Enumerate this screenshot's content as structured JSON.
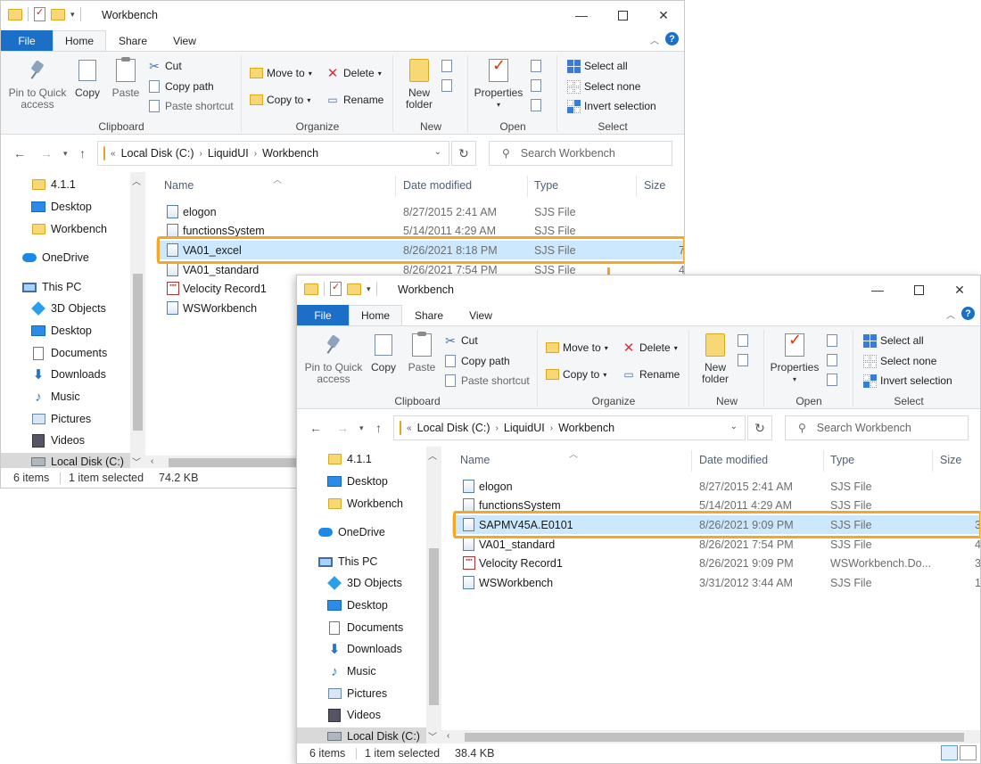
{
  "windows": [
    {
      "title": "Workbench",
      "tabs": {
        "file": "File",
        "home": "Home",
        "share": "Share",
        "view": "View"
      },
      "ribbon": {
        "pin_label": "Pin to Quick access",
        "copy": "Copy",
        "paste": "Paste",
        "cut": "Cut",
        "copy_path": "Copy path",
        "paste_shortcut": "Paste shortcut",
        "clipboard": "Clipboard",
        "move_to": "Move to",
        "copy_to": "Copy to",
        "delete": "Delete",
        "rename": "Rename",
        "organize": "Organize",
        "new_folder": "New folder",
        "new": "New",
        "properties": "Properties",
        "open": "Open",
        "select_all": "Select all",
        "select_none": "Select none",
        "invert_selection": "Invert selection",
        "select": "Select"
      },
      "address": {
        "prefix": "«",
        "crumbs": [
          "Local Disk (C:)",
          "LiquidUI",
          "Workbench"
        ]
      },
      "search_placeholder": "Search Workbench",
      "nav": [
        "4.1.1",
        "Desktop",
        "Workbench",
        "OneDrive",
        "This PC",
        "3D Objects",
        "Desktop",
        "Documents",
        "Downloads",
        "Music",
        "Pictures",
        "Videos",
        "Local Disk (C:)"
      ],
      "columns": {
        "name": "Name",
        "date": "Date modified",
        "type": "Type",
        "size": "Size"
      },
      "files": [
        {
          "name": "elogon",
          "date": "8/27/2015 2:41 AM",
          "type": "SJS File",
          "size": "",
          "icon": "sjs"
        },
        {
          "name": "functionsSystem",
          "date": "5/14/2011 4:29 AM",
          "type": "SJS File",
          "size": "",
          "icon": "sjs"
        },
        {
          "name": "VA01_excel",
          "date": "8/26/2021 8:18 PM",
          "type": "SJS File",
          "size": "7",
          "icon": "sjs"
        },
        {
          "name": "VA01_standard",
          "date": "8/26/2021 7:54 PM",
          "type": "SJS File",
          "size": "4",
          "icon": "sjs"
        },
        {
          "name": "Velocity Record1",
          "date": "",
          "type": "",
          "size": "",
          "icon": "rec"
        },
        {
          "name": "WSWorkbench",
          "date": "",
          "type": "",
          "size": "",
          "icon": "sjs"
        }
      ],
      "status": {
        "count": "6 items",
        "selected": "1 item selected",
        "size": "74.2 KB"
      }
    },
    {
      "title": "Workbench",
      "tabs": {
        "file": "File",
        "home": "Home",
        "share": "Share",
        "view": "View"
      },
      "ribbon": {
        "pin_label": "Pin to Quick access",
        "copy": "Copy",
        "paste": "Paste",
        "cut": "Cut",
        "copy_path": "Copy path",
        "paste_shortcut": "Paste shortcut",
        "clipboard": "Clipboard",
        "move_to": "Move to",
        "copy_to": "Copy to",
        "delete": "Delete",
        "rename": "Rename",
        "organize": "Organize",
        "new_folder": "New folder",
        "new": "New",
        "properties": "Properties",
        "open": "Open",
        "select_all": "Select all",
        "select_none": "Select none",
        "invert_selection": "Invert selection",
        "select": "Select"
      },
      "address": {
        "prefix": "«",
        "crumbs": [
          "Local Disk (C:)",
          "LiquidUI",
          "Workbench"
        ]
      },
      "search_placeholder": "Search Workbench",
      "nav": [
        "4.1.1",
        "Desktop",
        "Workbench",
        "OneDrive",
        "This PC",
        "3D Objects",
        "Desktop",
        "Documents",
        "Downloads",
        "Music",
        "Pictures",
        "Videos",
        "Local Disk (C:)"
      ],
      "columns": {
        "name": "Name",
        "date": "Date modified",
        "type": "Type",
        "size": "Size"
      },
      "files": [
        {
          "name": "elogon",
          "date": "8/27/2015 2:41 AM",
          "type": "SJS File",
          "size": "",
          "icon": "sjs"
        },
        {
          "name": "functionsSystem",
          "date": "5/14/2011 4:29 AM",
          "type": "SJS File",
          "size": "",
          "icon": "sjs"
        },
        {
          "name": "SAPMV45A.E0101",
          "date": "8/26/2021 9:09 PM",
          "type": "SJS File",
          "size": "3",
          "icon": "sjs"
        },
        {
          "name": "VA01_standard",
          "date": "8/26/2021 7:54 PM",
          "type": "SJS File",
          "size": "4",
          "icon": "sjs"
        },
        {
          "name": "Velocity Record1",
          "date": "8/26/2021 9:09 PM",
          "type": "WSWorkbench.Do...",
          "size": "3",
          "icon": "rec"
        },
        {
          "name": "WSWorkbench",
          "date": "3/31/2012 3:44 AM",
          "type": "SJS File",
          "size": "1",
          "icon": "sjs"
        }
      ],
      "status": {
        "count": "6 items",
        "selected": "1 item selected",
        "size": "38.4 KB"
      }
    }
  ],
  "colors": {
    "accent": "#1b6fc6",
    "highlight": "#f5a623",
    "selection": "#cce8ff"
  }
}
